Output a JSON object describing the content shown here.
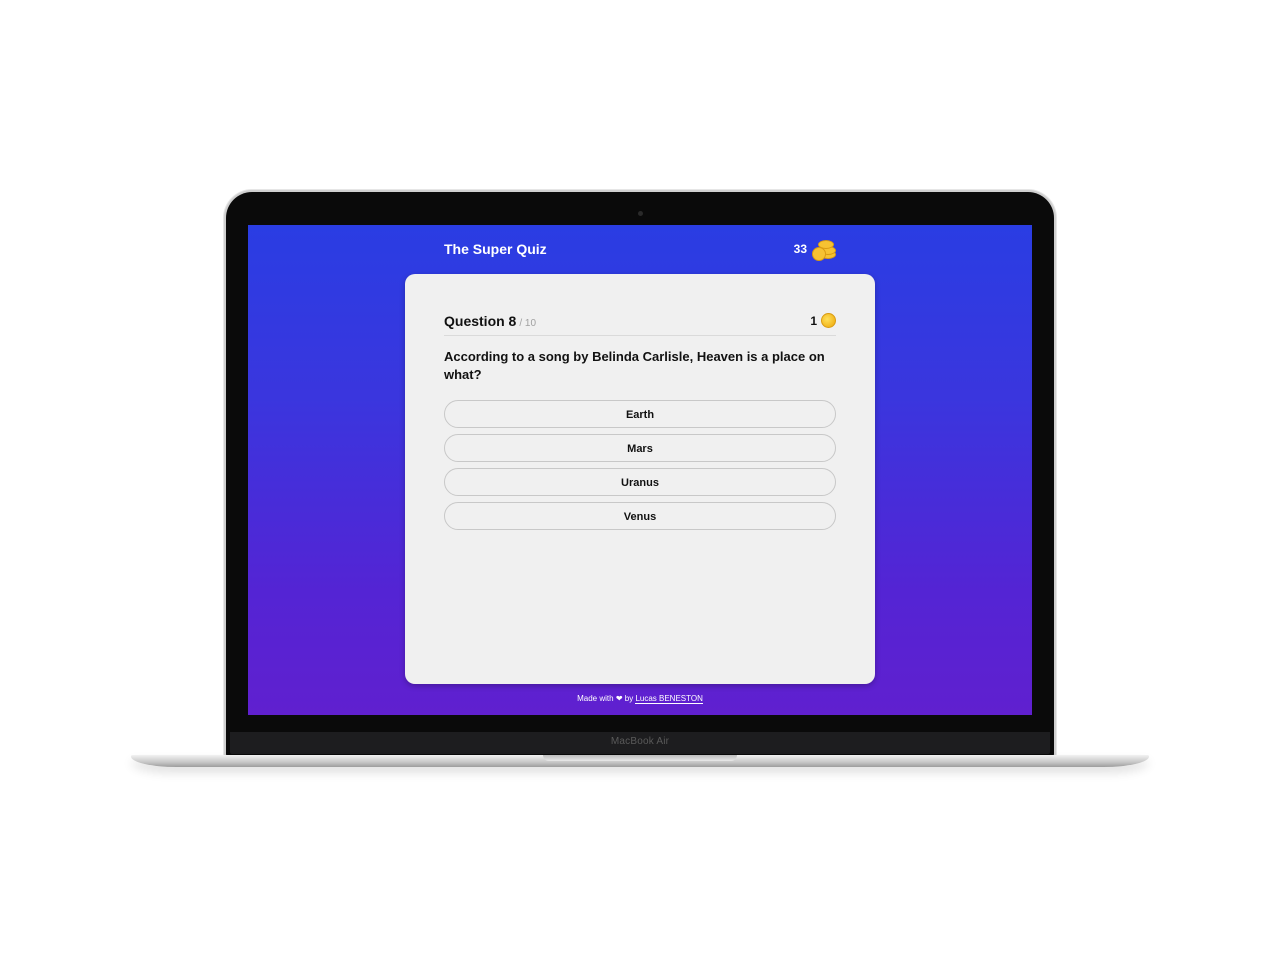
{
  "device": {
    "brand_label": "MacBook Air"
  },
  "app": {
    "title": "The Super Quiz",
    "total_coins": "33",
    "coin_icon": "coin-stack-icon"
  },
  "question": {
    "label": "Question 8",
    "total": "/ 10",
    "reward": "1",
    "text": "According to a song by Belinda Carlisle, Heaven is a place on what?",
    "answers": [
      "Earth",
      "Mars",
      "Uranus",
      "Venus"
    ]
  },
  "footer": {
    "made_with": "Made with",
    "heart": "❤",
    "by": "by",
    "author": "Lucas BENESTON"
  },
  "colors": {
    "gradient_top": "#2a3de3",
    "gradient_bottom": "#6020cf",
    "card": "#f0f0f0",
    "coin": "#f6c232"
  }
}
